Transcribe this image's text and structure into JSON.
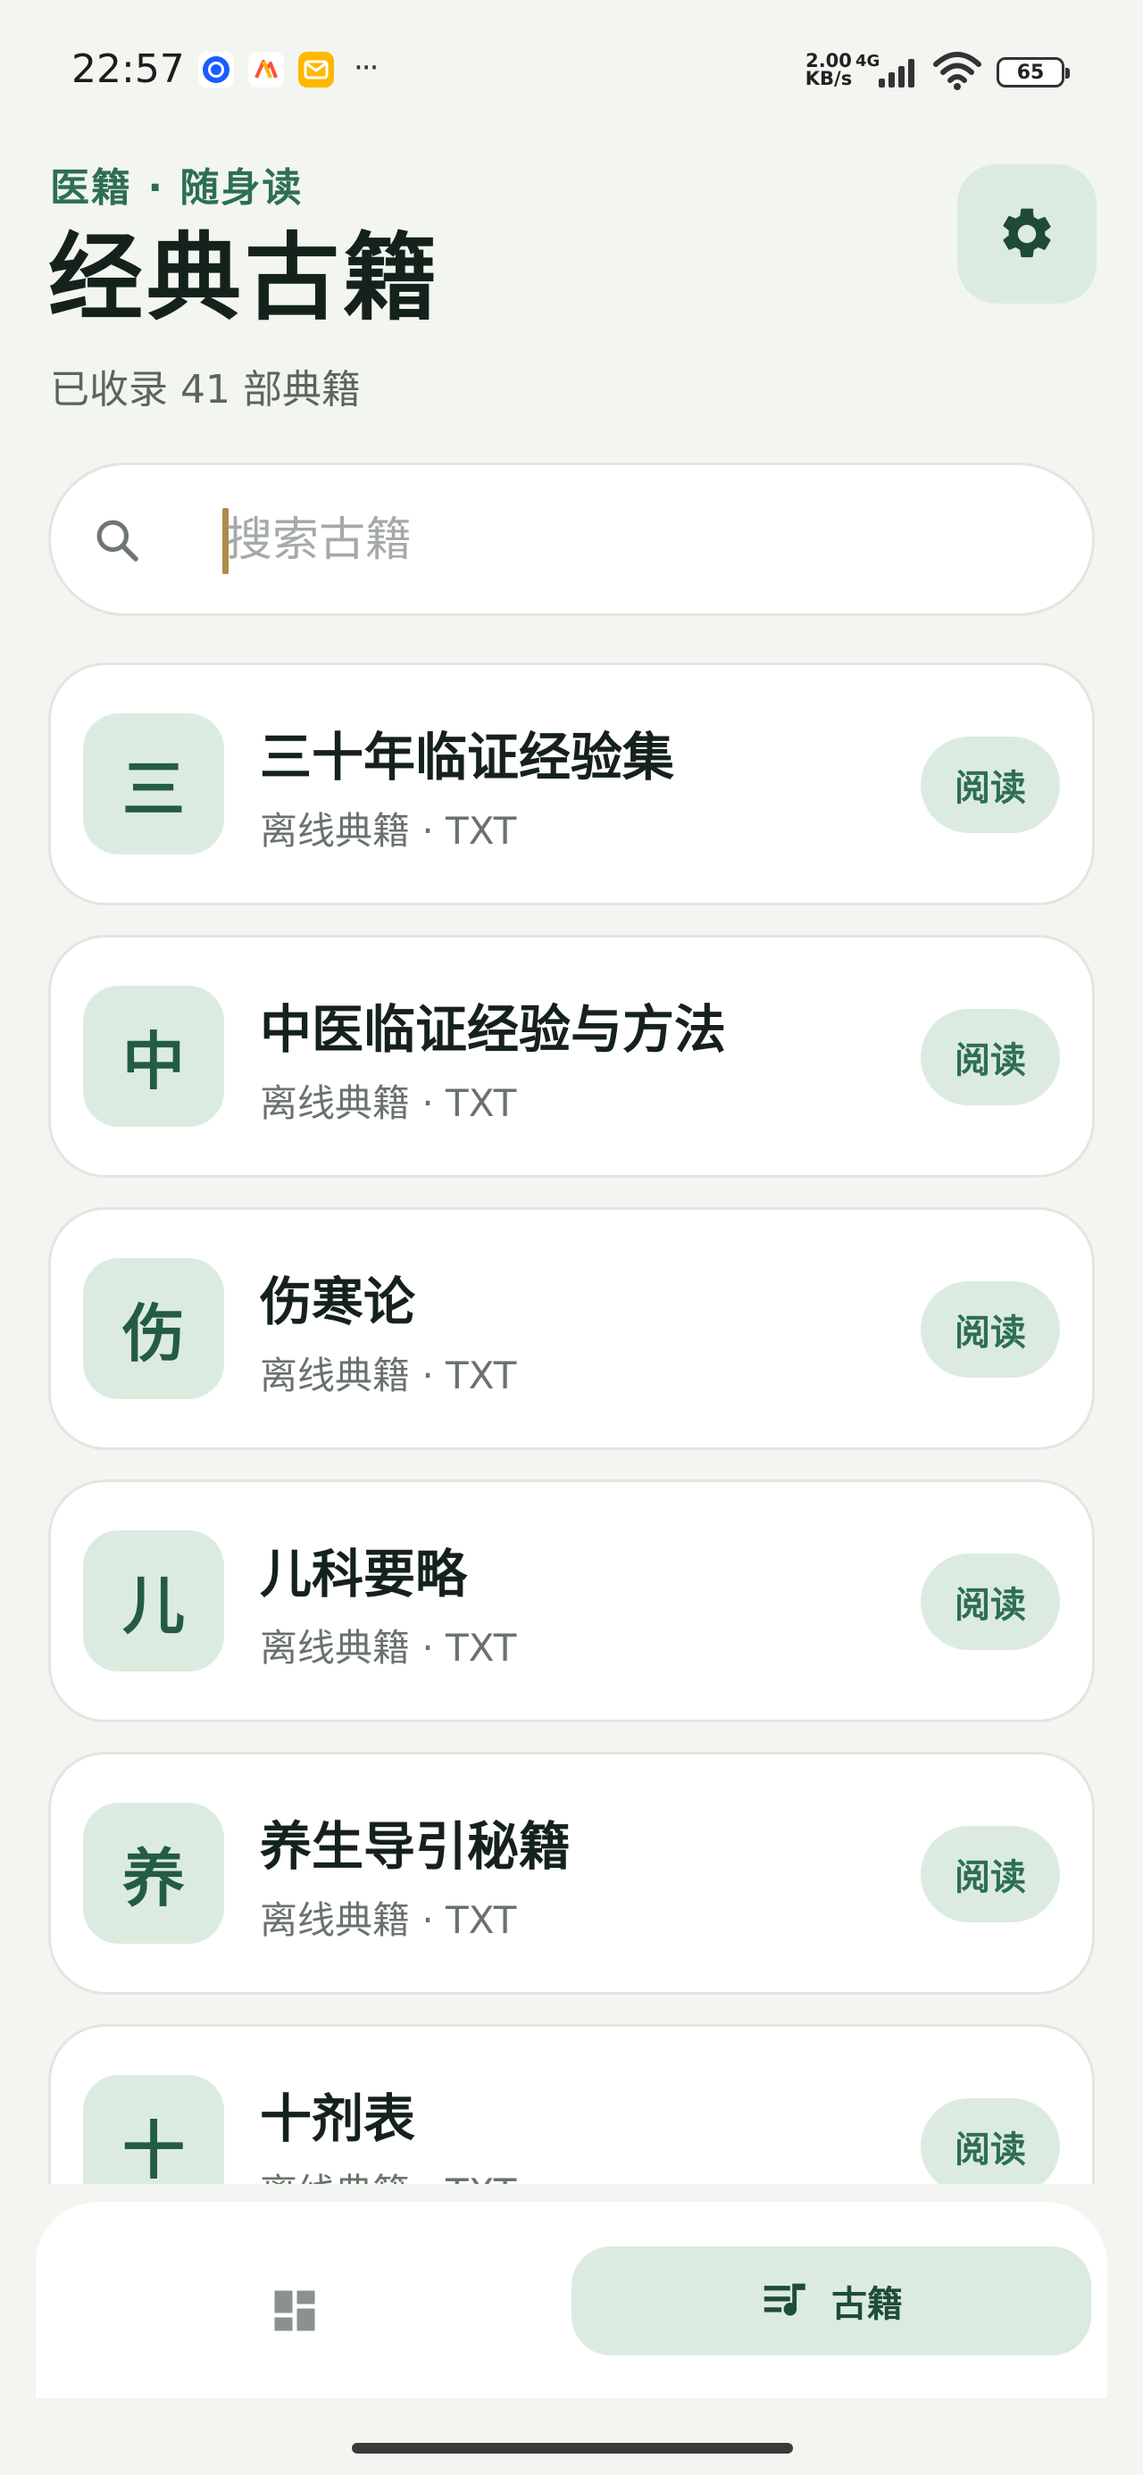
{
  "status_bar": {
    "time": "22:57",
    "notif_icons": [
      "browser-icon",
      "maps-icon",
      "mail-icon"
    ],
    "more": "···",
    "net_speed": "2.00 KB/s",
    "net_type": "4G",
    "battery": "65"
  },
  "header": {
    "subtitle": "医籍 · 随身读",
    "title": "经典古籍",
    "count": "已收录 41 部典籍"
  },
  "search": {
    "placeholder": "搜索古籍",
    "value": ""
  },
  "books": [
    {
      "initial": "三",
      "title": "三十年临证经验集",
      "meta": "离线典籍 · TXT",
      "action": "阅读"
    },
    {
      "initial": "中",
      "title": "中医临证经验与方法",
      "meta": "离线典籍 · TXT",
      "action": "阅读"
    },
    {
      "initial": "伤",
      "title": "伤寒论",
      "meta": "离线典籍 · TXT",
      "action": "阅读"
    },
    {
      "initial": "儿",
      "title": "儿科要略",
      "meta": "离线典籍 · TXT",
      "action": "阅读"
    },
    {
      "initial": "养",
      "title": "养生导引秘籍",
      "meta": "离线典籍 · TXT",
      "action": "阅读"
    },
    {
      "initial": "十",
      "title": "十剂表",
      "meta": "离线典籍 · TXT",
      "action": "阅读"
    }
  ],
  "bottom_nav": {
    "home_icon": "dashboard-icon",
    "books_icon": "playlist-music-icon",
    "books_label": "古籍"
  },
  "colors": {
    "accent": "#2e6f52",
    "accent_light": "#dcebe0",
    "background": "#f3f5f1",
    "card": "#ffffff"
  }
}
